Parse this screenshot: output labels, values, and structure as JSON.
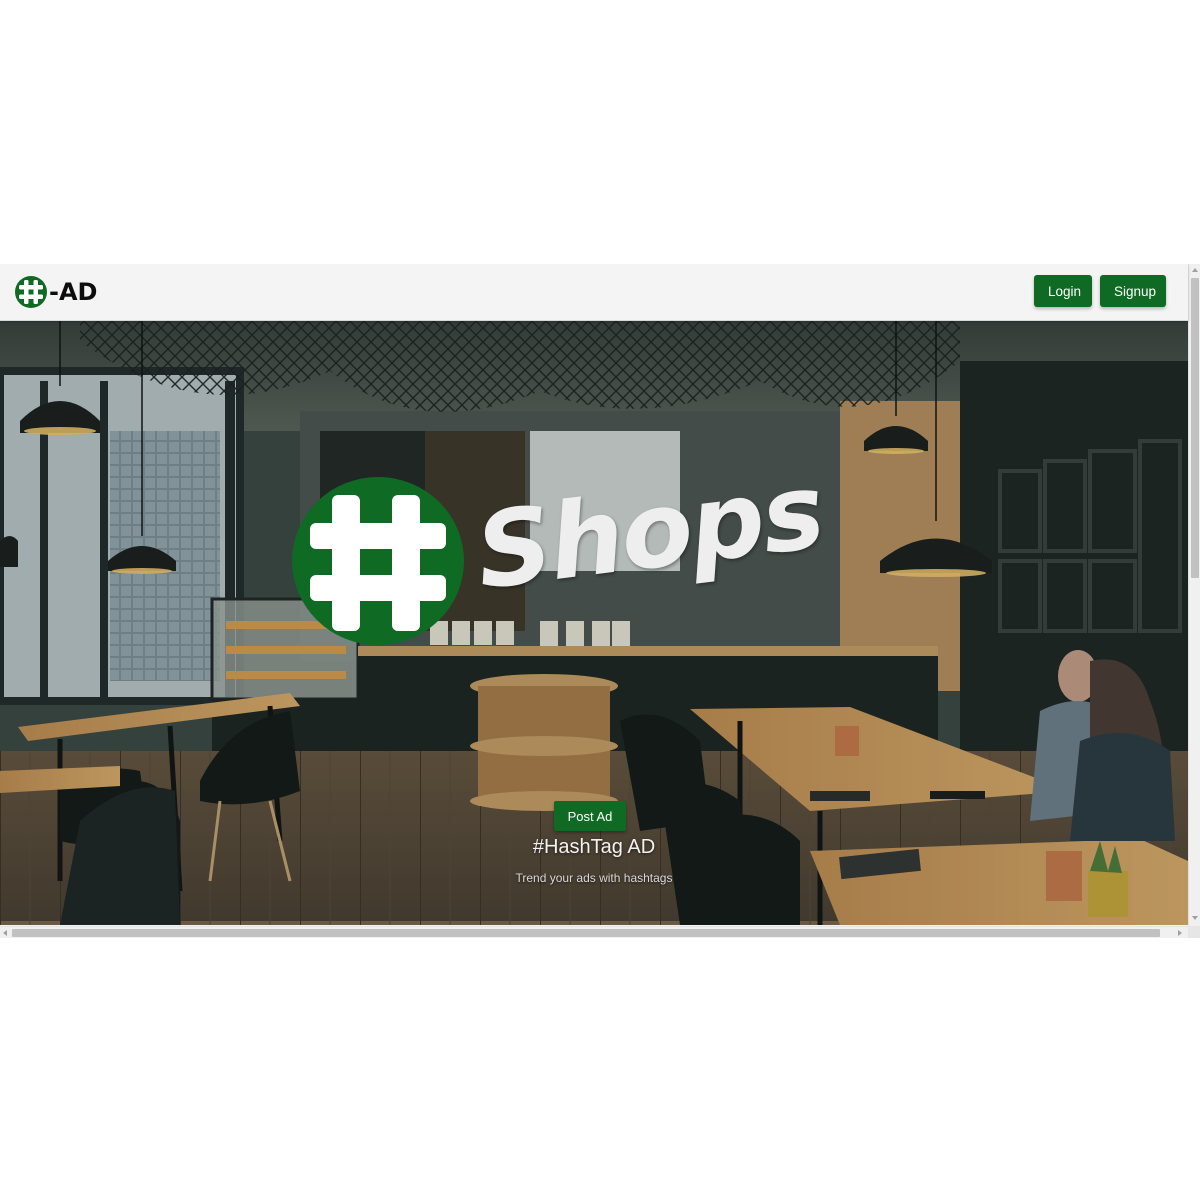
{
  "brand": {
    "logo_icon": "hashtag-circle-icon",
    "text": "-AD",
    "color": "#0f6b24"
  },
  "nav": {
    "login_label": "Login",
    "signup_label": "Signup"
  },
  "hero": {
    "background_image": "cafe-interior-photo",
    "logo_icon": "hashtag-circle-icon",
    "word": "Shops",
    "post_button_label": "Post Ad",
    "title": "#HashTag AD",
    "subtitle": "Trend your ads with hashtags"
  },
  "colors": {
    "accent": "#0f6b24",
    "navbar_bg": "#f4f4f4",
    "button_text": "#ffffff"
  }
}
